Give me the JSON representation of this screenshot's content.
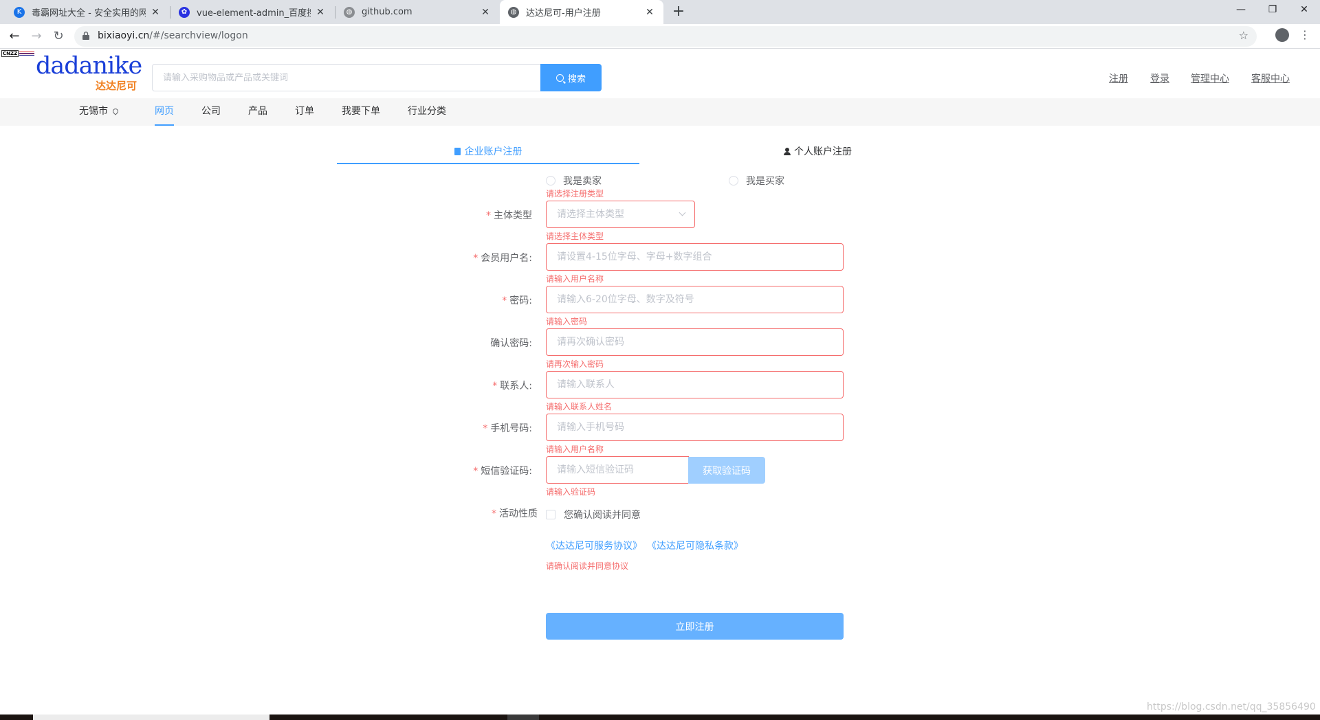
{
  "browser": {
    "tabs": [
      {
        "title": "毒霸网址大全 - 安全实用的网址导航",
        "favicon": "k-logo-icon",
        "color": "#1a73e8"
      },
      {
        "title": "vue-element-admin_百度搜索",
        "favicon": "baidu-paw-icon",
        "color": "#2932e1"
      },
      {
        "title": "github.com",
        "favicon": "globe-icon",
        "color": "#5f6368"
      },
      {
        "title": "达达尼可-用户注册",
        "favicon": "globe-icon",
        "color": "#5f6368"
      }
    ],
    "url_host": "bixiaoyi.cn",
    "url_path": "/#/searchview/logon"
  },
  "header": {
    "cnzz": "CNZZ",
    "logo_en": "dadanike",
    "logo_cn": "达达尼可",
    "search_placeholder": "请输入采购物品或产品或关键词",
    "search_button": "搜索",
    "links": [
      "注册",
      "登录",
      "管理中心",
      "客服中心"
    ]
  },
  "nav": {
    "city": "无锡市",
    "items": [
      "网页",
      "公司",
      "产品",
      "订单",
      "我要下单",
      "行业分类"
    ],
    "active_index": 0
  },
  "register": {
    "tabs": [
      "企业账户注册",
      "个人账户注册"
    ],
    "role_options": [
      "我是卖家",
      "我是买家"
    ],
    "role_error": "请选择注册类型",
    "fields": [
      {
        "label": "主体类型",
        "required": true,
        "placeholder": "请选择主体类型",
        "error": "请选择主体类型"
      },
      {
        "label": "会员用户名:",
        "required": true,
        "placeholder": "请设置4-15位字母、字母+数字组合",
        "error": "请输入用户名称"
      },
      {
        "label": "密码:",
        "required": true,
        "placeholder": "请输入6-20位字母、数字及符号",
        "error": "请输入密码"
      },
      {
        "label": "确认密码:",
        "required": false,
        "placeholder": "请再次确认密码",
        "error": "请再次输入密码"
      },
      {
        "label": "联系人:",
        "required": true,
        "placeholder": "请输入联系人",
        "error": "请输入联系人姓名"
      },
      {
        "label": "手机号码:",
        "required": true,
        "placeholder": "请输入手机号码",
        "error": "请输入用户名称"
      },
      {
        "label": "短信验证码:",
        "required": true,
        "placeholder": "请输入短信验证码",
        "error": "请输入验证码"
      }
    ],
    "sms_button": "获取验证码",
    "activity_label": "活动性质",
    "agree_text": "您确认阅读并同意",
    "agreements": [
      "《达达尼可服务协议》",
      "《达达尼可隐私条款》"
    ],
    "agree_error": "请确认阅读并同意协议",
    "submit": "立即注册"
  },
  "watermark": "https://blog.csdn.net/qq_35856490"
}
